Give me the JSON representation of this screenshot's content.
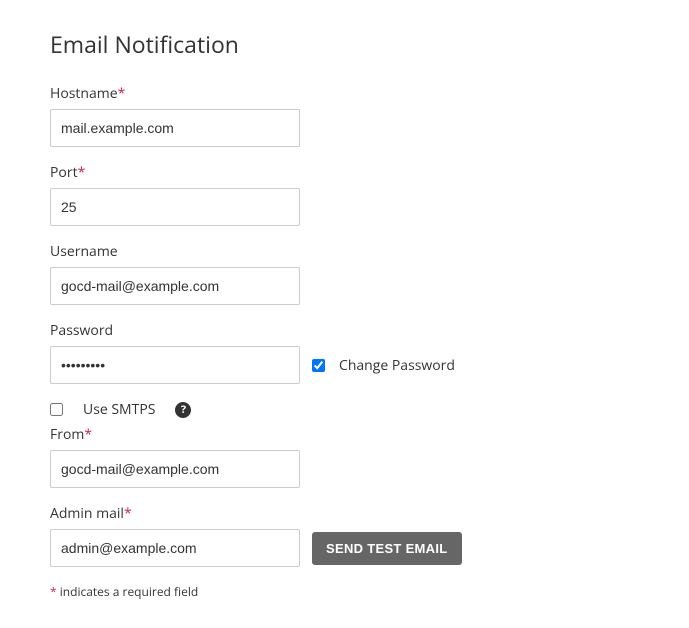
{
  "title": "Email Notification",
  "fields": {
    "hostname": {
      "label": "Hostname",
      "required": true,
      "value": "mail.example.com"
    },
    "port": {
      "label": "Port",
      "required": true,
      "value": "25"
    },
    "username": {
      "label": "Username",
      "required": false,
      "value": "gocd-mail@example.com"
    },
    "password": {
      "label": "Password",
      "required": false,
      "value": "•••••••••"
    },
    "change_password": {
      "label": "Change Password",
      "checked": true
    },
    "use_smtps": {
      "label": "Use SMTPS",
      "checked": false
    },
    "from": {
      "label": "From",
      "required": true,
      "value": "gocd-mail@example.com"
    },
    "admin_mail": {
      "label": "Admin mail",
      "required": true,
      "value": "admin@example.com"
    }
  },
  "buttons": {
    "send_test": "Send Test Email"
  },
  "footnote": {
    "star": "*",
    "text": " indicates a required field"
  },
  "asterisk": "*"
}
